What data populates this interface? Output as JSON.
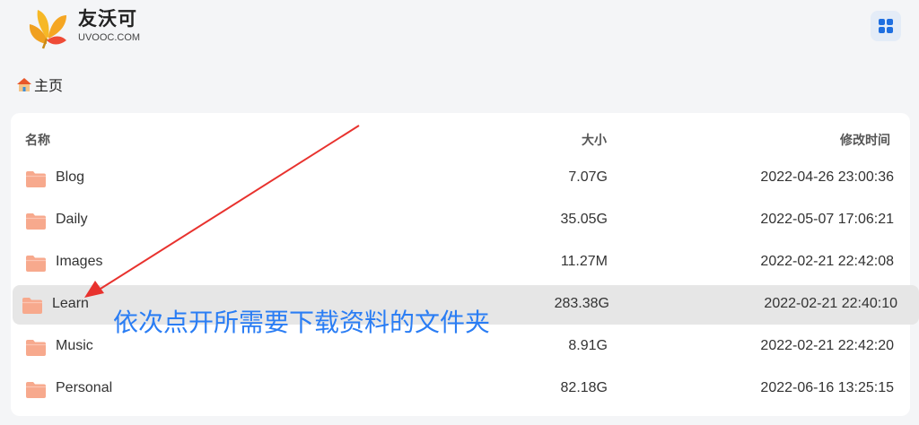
{
  "brand": {
    "name": "友沃可",
    "domain": "UVOOC.COM"
  },
  "breadcrumb": {
    "home_label": "主页"
  },
  "table": {
    "headers": {
      "name": "名称",
      "size": "大小",
      "modified": "修改时间"
    },
    "rows": [
      {
        "name": "Blog",
        "size": "7.07G",
        "modified": "2022-04-26 23:00:36"
      },
      {
        "name": "Daily",
        "size": "35.05G",
        "modified": "2022-05-07 17:06:21"
      },
      {
        "name": "Images",
        "size": "11.27M",
        "modified": "2022-02-21 22:42:08"
      },
      {
        "name": "Learn",
        "size": "283.38G",
        "modified": "2022-02-21 22:40:10",
        "selected": true
      },
      {
        "name": "Music",
        "size": "8.91G",
        "modified": "2022-02-21 22:42:20"
      },
      {
        "name": "Personal",
        "size": "82.18G",
        "modified": "2022-06-16 13:25:15"
      }
    ]
  },
  "annotation": {
    "text": "依次点开所需要下载资料的文件夹",
    "color": "#2a7df4",
    "arrow_color": "#e8322e"
  },
  "colors": {
    "folder": "#f7a98d",
    "accent": "#1f6fe0"
  }
}
